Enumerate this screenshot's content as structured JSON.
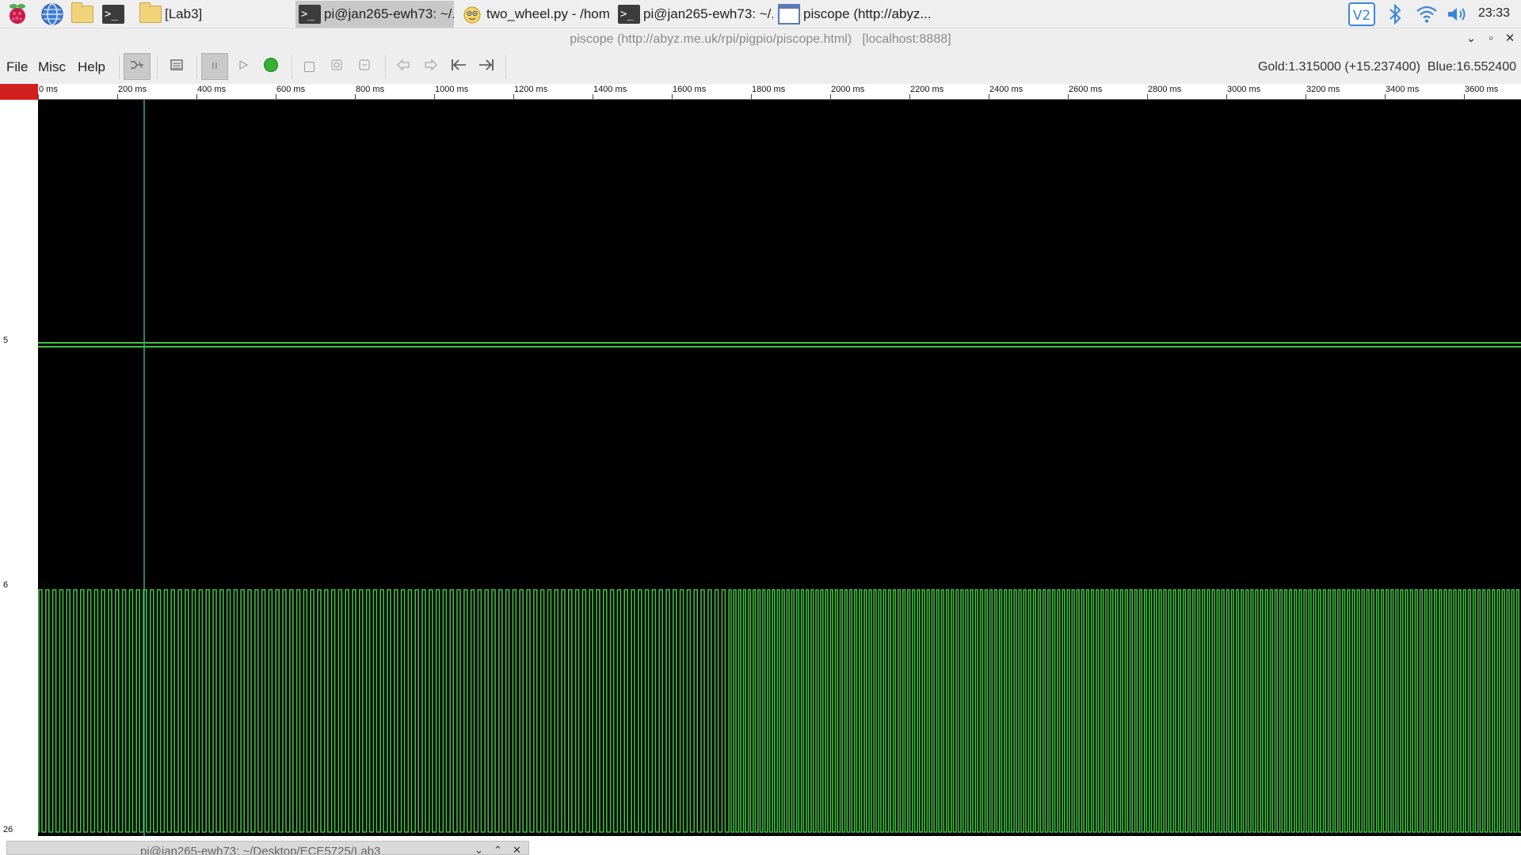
{
  "taskbar": {
    "launchers": [
      {
        "name": "raspberry-menu-icon"
      },
      {
        "name": "web-browser-icon"
      },
      {
        "name": "file-manager-icon"
      },
      {
        "name": "terminal-icon"
      }
    ],
    "tasks": [
      {
        "label": "[Lab3]",
        "icon": "folder-icon",
        "active": false
      },
      {
        "label": "pi@jan265-ewh73: ~/...",
        "icon": "terminal-icon",
        "active": true
      },
      {
        "label": "two_wheel.py - /hom...",
        "icon": "thonny-icon",
        "active": false
      },
      {
        "label": "pi@jan265-ewh73: ~/...",
        "icon": "terminal-icon",
        "active": false
      },
      {
        "label": "piscope (http://abyz....",
        "icon": "window-icon",
        "active": false
      }
    ],
    "tray": [
      "vnc-icon",
      "bluetooth-icon",
      "wifi-icon",
      "volume-icon"
    ],
    "clock": "23:33"
  },
  "window": {
    "title": "piscope (http://abyz.me.uk/rpi/pigpio/piscope.html)   [localhost:8888]",
    "controls": {
      "minimize": "⌄",
      "maximize": "▫",
      "close": "✕"
    }
  },
  "menubar": {
    "items": [
      "File",
      "Misc",
      "Help"
    ]
  },
  "toolbar": {
    "buttons": [
      {
        "name": "trigger-mode-icon",
        "pressed": true
      },
      {
        "name": "display-settings-icon",
        "pressed": false
      },
      {
        "name": "pause-icon",
        "pressed": true
      },
      {
        "name": "play-icon",
        "pressed": false
      },
      {
        "name": "record-icon",
        "pressed": false
      },
      {
        "name": "gold-marker-icon",
        "pressed": false
      },
      {
        "name": "blue-marker-icon",
        "pressed": false
      },
      {
        "name": "clear-marker-icon",
        "pressed": false
      },
      {
        "name": "scroll-left-icon",
        "pressed": false
      },
      {
        "name": "scroll-right-icon",
        "pressed": false
      },
      {
        "name": "go-to-start-icon",
        "pressed": false
      },
      {
        "name": "go-to-end-icon",
        "pressed": false
      }
    ],
    "readout": "Gold:1.315000 (+15.237400)  Blue:16.552400"
  },
  "scope": {
    "time_ticks": [
      "0 ms",
      "200 ms",
      "400 ms",
      "600 ms",
      "800 ms",
      "1000 ms",
      "1200 ms",
      "1400 ms",
      "1600 ms",
      "1800 ms",
      "2000 ms",
      "2200 ms",
      "2400 ms",
      "2600 ms",
      "2800 ms",
      "3000 ms",
      "3200 ms",
      "3400 ms",
      "3600 ms"
    ],
    "gpio_labels": [
      "5",
      "6",
      "26"
    ],
    "marker_time_ms": 268,
    "trace_color": "#3fc23f",
    "marker_color": "#2aa79a",
    "ruler_marker_color": "#d11f1f"
  },
  "bottom_window": {
    "title": "pi@jan265-ewh73: ~/Desktop/ECE5725/Lab3",
    "controls": [
      "⌄",
      "⌃",
      "✕"
    ]
  }
}
